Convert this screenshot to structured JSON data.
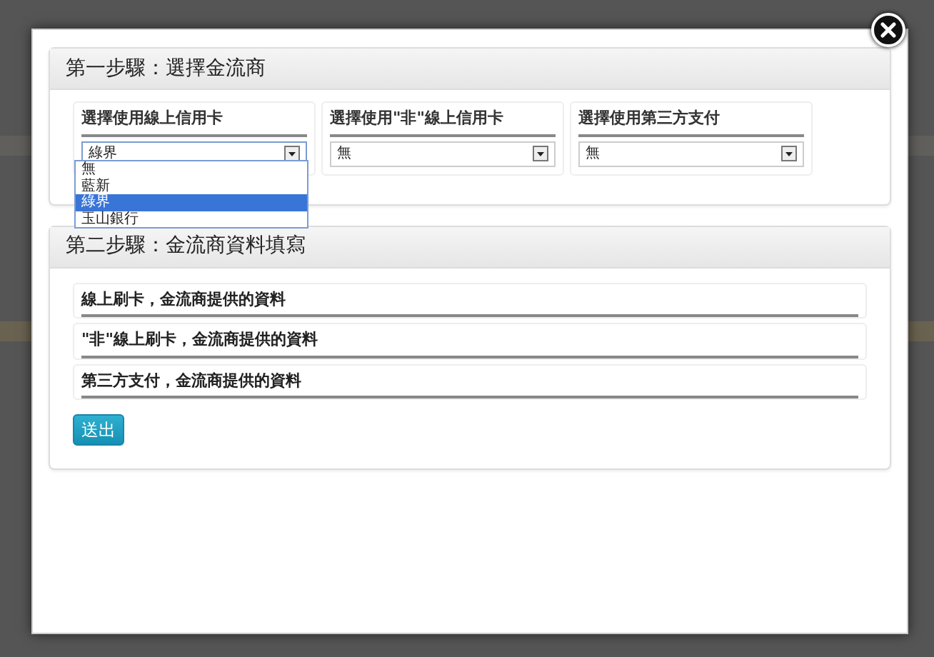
{
  "step1": {
    "title": "第一步驟：選擇金流商",
    "selects": [
      {
        "label": "選擇使用線上信用卡",
        "value": "綠界",
        "expanded": true,
        "options": [
          {
            "label": "無",
            "selected": false
          },
          {
            "label": "藍新",
            "selected": false
          },
          {
            "label": "綠界",
            "selected": true
          },
          {
            "label": "玉山銀行",
            "selected": false
          }
        ]
      },
      {
        "label": "選擇使用\"非\"線上信用卡",
        "value": "無",
        "expanded": false
      },
      {
        "label": "選擇使用第三方支付",
        "value": "無",
        "expanded": false
      }
    ]
  },
  "step2": {
    "title": "第二步驟：金流商資料填寫",
    "sections": [
      "線上刷卡，金流商提供的資料",
      "\"非\"線上刷卡，金流商提供的資料",
      "第三方支付，金流商提供的資料"
    ],
    "submit": "送出"
  }
}
